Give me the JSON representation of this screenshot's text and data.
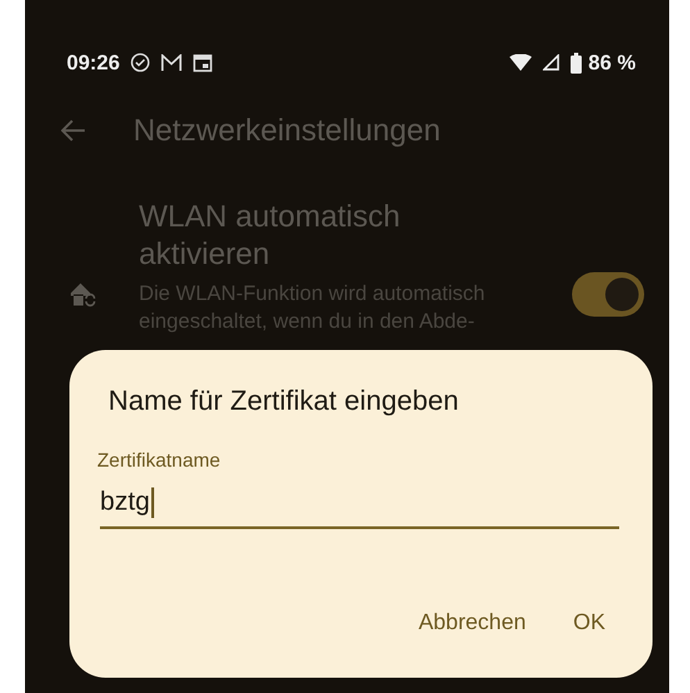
{
  "status_bar": {
    "time": "09:26",
    "battery": "86 %"
  },
  "app_bar": {
    "title": "Netzwerkeinstellungen"
  },
  "settings": [
    {
      "title": "WLAN automatisch aktivieren",
      "summary": "Die WLAN-Funktion wird automatisch eingeschaltet, wenn du in den Abde-",
      "on": true
    }
  ],
  "dialog": {
    "title": "Name für Zertifikat eingeben",
    "field": {
      "label": "Zertifikatname",
      "value": "bztg"
    },
    "buttons": [
      {
        "label": "Abbrechen"
      },
      {
        "label": "OK"
      }
    ]
  }
}
